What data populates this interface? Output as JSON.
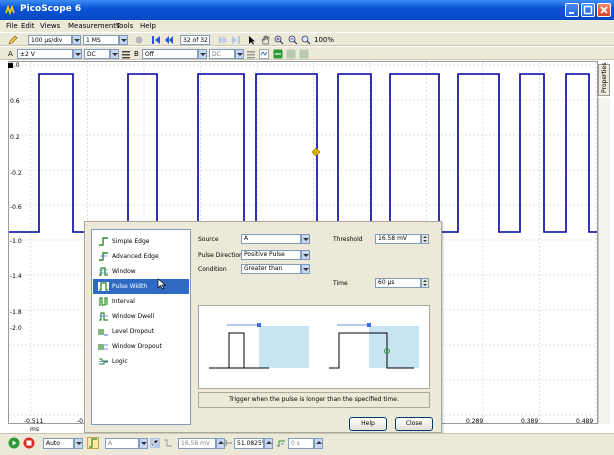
{
  "window": {
    "title": "PicoScope 6"
  },
  "menu": [
    "File",
    "Edit",
    "Views",
    "Measurements",
    "Tools",
    "Help"
  ],
  "toolbar1": {
    "timebase": "100 μs/div",
    "samples": "1 MS",
    "buffer": "32 of 32",
    "zoom": "100%"
  },
  "toolbar2": {
    "channel_a_label": "A",
    "channel_a_range": "±2 V",
    "channel_a_coupling": "DC",
    "channel_b_label": "B",
    "channel_b_range": "Off",
    "channel_b_coupling": "DC"
  },
  "scope": {
    "y_ticks": [
      "1.0",
      "0.6",
      "0.2",
      "-0.2",
      "-0.6",
      "-1.0",
      "-1.4",
      "-1.8",
      "-2.0"
    ],
    "x_ticks": [
      "-0.511",
      "-0.4",
      "0.289",
      "0.389",
      "0.489"
    ],
    "x_unit": "ms",
    "trace_color": "#0000a0",
    "trigger_marker_color": "#e0b000",
    "side_tab": "Properties"
  },
  "trigger_dialog": {
    "types": [
      {
        "label": "Simple Edge",
        "icon": "simple-edge-icon"
      },
      {
        "label": "Advanced Edge",
        "icon": "advanced-edge-icon"
      },
      {
        "label": "Window",
        "icon": "window-icon"
      },
      {
        "label": "Pulse Width",
        "icon": "pulse-width-icon"
      },
      {
        "label": "Interval",
        "icon": "interval-icon"
      },
      {
        "label": "Window Dwell",
        "icon": "window-dwell-icon"
      },
      {
        "label": "Level Dropout",
        "icon": "level-dropout-icon"
      },
      {
        "label": "Window Dropout",
        "icon": "window-dropout-icon"
      },
      {
        "label": "Logic",
        "icon": "logic-icon"
      }
    ],
    "selected": "Pulse Width",
    "source_label": "Source",
    "source_value": "A",
    "pulse_direction_label": "Pulse Direction",
    "pulse_direction_value": "Positive Pulse",
    "condition_label": "Condition",
    "condition_value": "Greater than",
    "threshold_label": "Threshold",
    "threshold_value": "16.58 mV",
    "time_label": "Time",
    "time_value": "60 μs",
    "description": "Trigger when the pulse is longer than the specified time.",
    "help_label": "Help",
    "close_label": "Close"
  },
  "statusbar": {
    "trigger_mode": "Auto",
    "trigger_channel": "A",
    "threshold": "16.58 mV",
    "pretrigger": "51.0825%",
    "delay": "0 s"
  }
}
